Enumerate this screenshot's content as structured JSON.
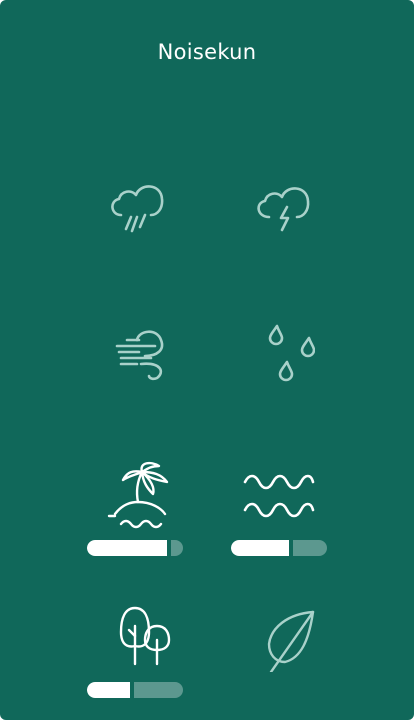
{
  "app": {
    "title": "Noisekun"
  },
  "sounds": [
    {
      "id": "rain",
      "icon": "rain-icon",
      "active": false,
      "volume": null
    },
    {
      "id": "storm",
      "icon": "lightning-cloud-icon",
      "active": false,
      "volume": null
    },
    {
      "id": "wind",
      "icon": "wind-icon",
      "active": false,
      "volume": null
    },
    {
      "id": "drops",
      "icon": "water-drops-icon",
      "active": false,
      "volume": null
    },
    {
      "id": "beach",
      "icon": "palm-island-icon",
      "active": true,
      "volume": 0.83
    },
    {
      "id": "waves",
      "icon": "waves-icon",
      "active": true,
      "volume": 0.6
    },
    {
      "id": "forest",
      "icon": "trees-icon",
      "active": true,
      "volume": 0.45
    },
    {
      "id": "leaves",
      "icon": "leaf-icon",
      "active": false,
      "volume": null
    }
  ],
  "colors": {
    "background": "#10685a",
    "icon_active": "#ffffff",
    "icon_inactive": "#a9d1ca",
    "slider_fill": "#ffffff",
    "slider_track": "rgba(255,255,255,0.32)"
  }
}
